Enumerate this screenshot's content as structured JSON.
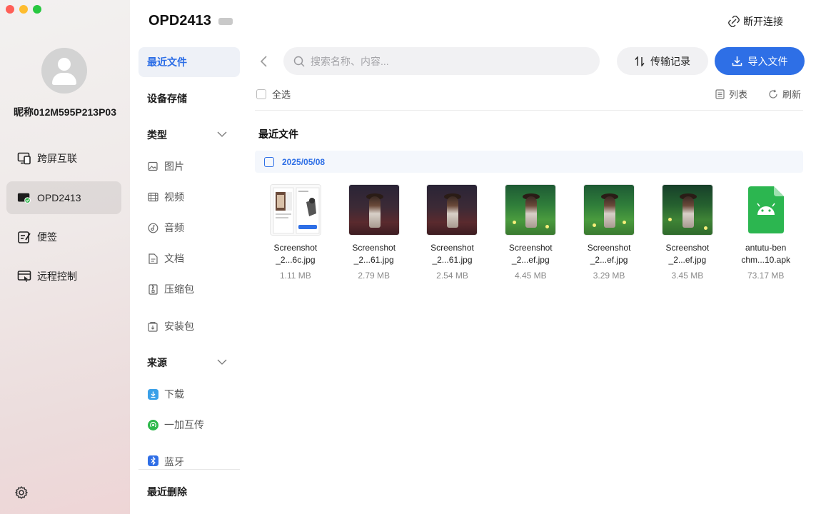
{
  "sidebar": {
    "nickname": "昵称012M595P213P03",
    "nav": [
      {
        "label": "跨屏互联",
        "icon": "cross-screen-icon"
      },
      {
        "label": "OPD2413",
        "icon": "tablet-device-icon",
        "active": true
      },
      {
        "label": "便签",
        "icon": "notes-icon"
      },
      {
        "label": "远程控制",
        "icon": "remote-control-icon"
      }
    ]
  },
  "header": {
    "device_name": "OPD2413",
    "disconnect_label": "断开连接"
  },
  "categories": {
    "recent_files": "最近文件",
    "device_storage": "设备存储",
    "type_header": "类型",
    "types": [
      "图片",
      "视频",
      "音频",
      "文档",
      "压缩包",
      "安装包"
    ],
    "source_header": "来源",
    "sources": [
      "下载",
      "一加互传",
      "蓝牙"
    ],
    "recently_deleted": "最近删除"
  },
  "toolbar": {
    "search_placeholder": "搜索名称、内容...",
    "transfer_record_label": "传输记录",
    "import_label": "导入文件",
    "select_all_label": "全选",
    "list_label": "列表",
    "refresh_label": "刷新"
  },
  "content": {
    "section_title": "最近文件",
    "date_group": "2025/05/08",
    "files": [
      {
        "name_line1": "Screenshot",
        "name_line2": "_2...6c.jpg",
        "size": "1.11 MB",
        "thumb": "phone"
      },
      {
        "name_line1": "Screenshot",
        "name_line2": "_2...61.jpg",
        "size": "2.79 MB",
        "thumb": "dark"
      },
      {
        "name_line1": "Screenshot",
        "name_line2": "_2...61.jpg",
        "size": "2.54 MB",
        "thumb": "dark"
      },
      {
        "name_line1": "Screenshot",
        "name_line2": "_2...ef.jpg",
        "size": "4.45 MB",
        "thumb": "green"
      },
      {
        "name_line1": "Screenshot",
        "name_line2": "_2...ef.jpg",
        "size": "3.29 MB",
        "thumb": "green"
      },
      {
        "name_line1": "Screenshot",
        "name_line2": "_2...ef.jpg",
        "size": "3.45 MB",
        "thumb": "green2"
      },
      {
        "name_line1": "antutu-ben",
        "name_line2": "chm...10.apk",
        "size": "73.17 MB",
        "thumb": "apk"
      }
    ]
  },
  "colors": {
    "accent": "#2e6fe6",
    "active_bg": "#eef1f7",
    "android_green": "#3ddc84"
  }
}
